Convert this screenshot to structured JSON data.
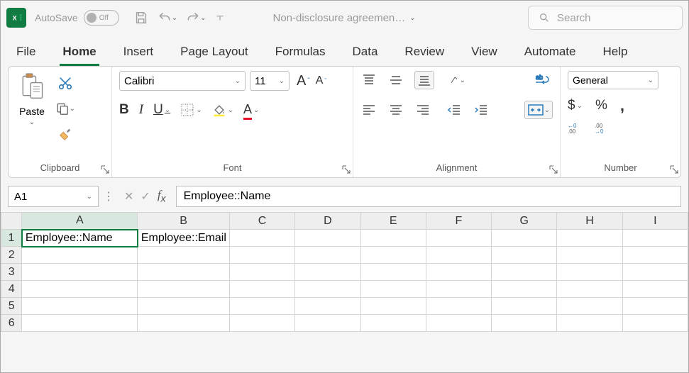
{
  "titlebar": {
    "autosave_label": "AutoSave",
    "autosave_state": "Off",
    "doc_title": "Non-disclosure agreemen…"
  },
  "search": {
    "placeholder": "Search"
  },
  "tabs": {
    "file": "File",
    "home": "Home",
    "insert": "Insert",
    "page_layout": "Page Layout",
    "formulas": "Formulas",
    "data": "Data",
    "review": "Review",
    "view": "View",
    "automate": "Automate",
    "help": "Help"
  },
  "clipboard": {
    "paste": "Paste",
    "label": "Clipboard"
  },
  "font": {
    "name": "Calibri",
    "size": "11",
    "bold": "B",
    "italic": "I",
    "underline": "U",
    "label": "Font"
  },
  "alignment": {
    "label": "Alignment"
  },
  "number": {
    "format": "General",
    "label": "Number"
  },
  "namebox": {
    "value": "A1"
  },
  "formula": {
    "value": "Employee::Name"
  },
  "columns": [
    "A",
    "B",
    "C",
    "D",
    "E",
    "F",
    "G",
    "H",
    "I"
  ],
  "rows": [
    "1",
    "2",
    "3",
    "4",
    "5",
    "6"
  ],
  "cells": {
    "A1": "Employee::Name",
    "B1": "Employee::Email"
  }
}
